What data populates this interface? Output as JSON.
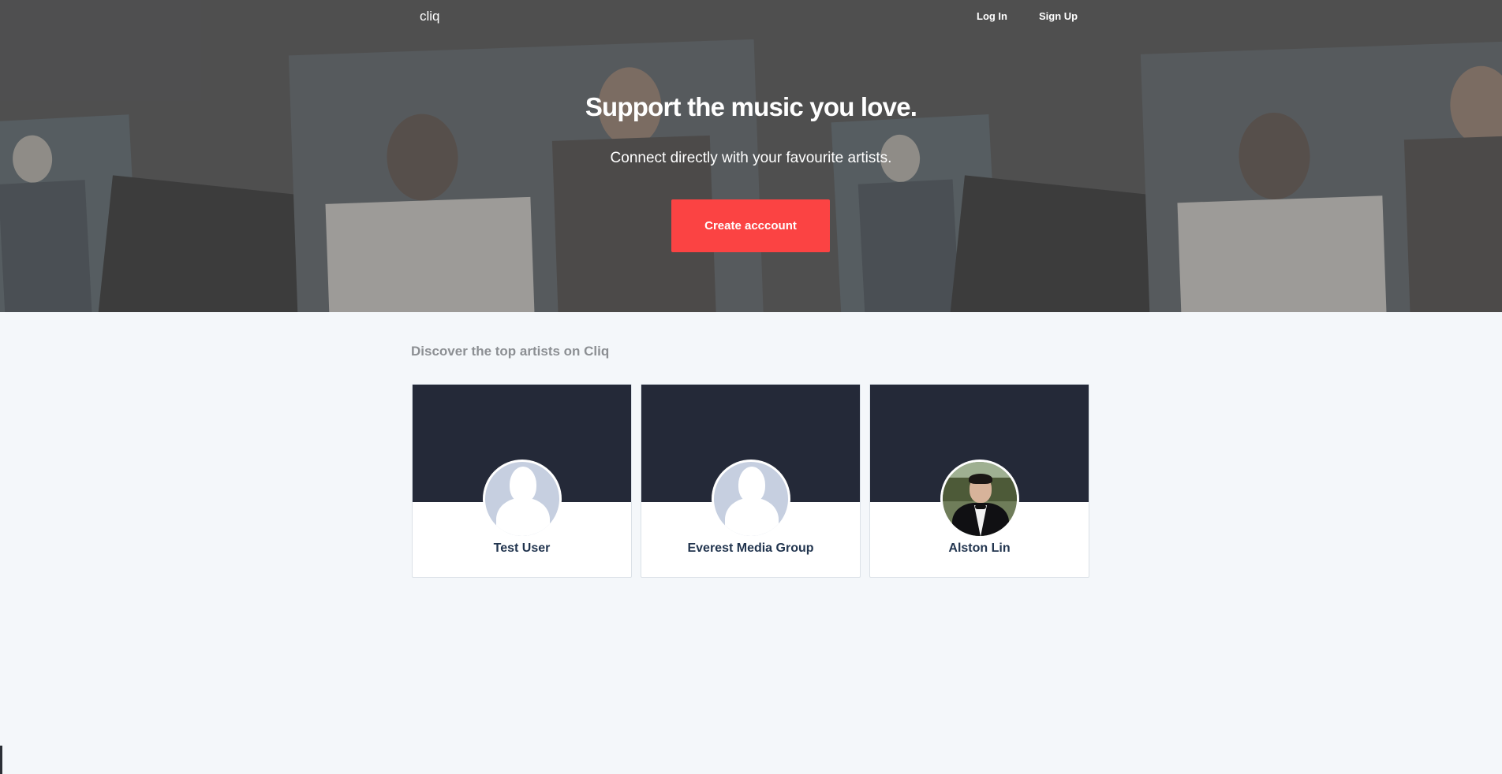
{
  "nav": {
    "brand": "cliq",
    "login_label": "Log In",
    "signup_label": "Sign Up"
  },
  "hero": {
    "title": "Support the music you love.",
    "subtitle": "Connect directly with your favourite artists.",
    "cta_label": "Create acccount"
  },
  "discover": {
    "heading": "Discover the top artists on Cliq",
    "artists": [
      {
        "name": "Test User",
        "avatar": "default-silhouette"
      },
      {
        "name": "Everest Media Group",
        "avatar": "default-silhouette"
      },
      {
        "name": "Alston Lin",
        "avatar": "profile-photo"
      }
    ]
  },
  "colors": {
    "accent": "#fb4343",
    "card_cover": "#242938",
    "page_bg": "#f4f7fa",
    "artist_name": "#22354f"
  }
}
